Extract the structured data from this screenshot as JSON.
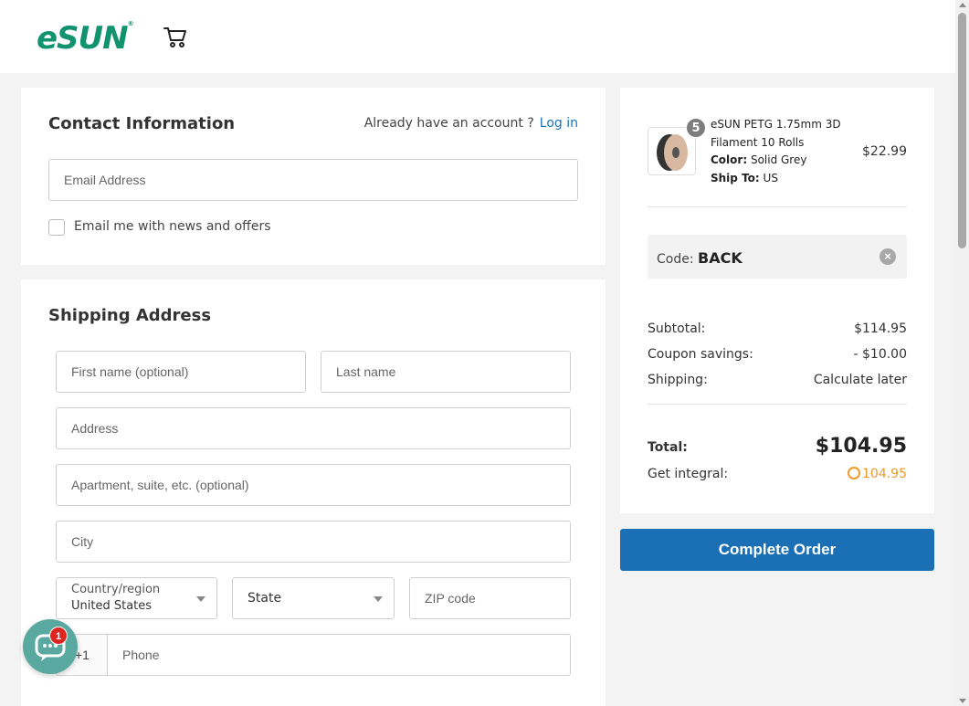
{
  "header": {
    "logo_text": "eSUN",
    "logo_mark": "®",
    "cart_icon": "cart-icon"
  },
  "contact": {
    "title": "Contact Information",
    "account_prompt": "Already have an account ?",
    "login_label": "Log in",
    "email_placeholder": "Email Address",
    "email_value": "",
    "newsletter_label": "Email me with news and offers",
    "newsletter_checked": false
  },
  "shipping": {
    "title": "Shipping Address",
    "first_name_placeholder": "First name (optional)",
    "last_name_placeholder": "Last name",
    "address_placeholder": "Address",
    "apartment_placeholder": "Apartment, suite, etc. (optional)",
    "city_placeholder": "City",
    "country_label": "Country/region",
    "country_value": "United States",
    "state_value": "State",
    "zip_placeholder": "ZIP code",
    "phone_prefix": "+1",
    "phone_placeholder": "Phone"
  },
  "summary": {
    "item": {
      "quantity": "5",
      "name": "eSUN PETG 1.75mm 3D Filament 10 Rolls",
      "color_label": "Color:",
      "color_value": "Solid Grey",
      "ship_label": "Ship To:",
      "ship_value": "US",
      "price": "$22.99"
    },
    "code_label": "Code:",
    "code_value": "BACK",
    "subtotal_label": "Subtotal:",
    "subtotal_value": "$114.95",
    "coupon_label": "Coupon savings:",
    "coupon_value": "- $10.00",
    "shipping_label": "Shipping:",
    "shipping_value": "Calculate later",
    "total_label": "Total:",
    "total_value": "$104.95",
    "integral_label": "Get integral:",
    "integral_value": "104.95"
  },
  "complete_button": "Complete Order",
  "chat": {
    "badge_count": "1"
  },
  "colors": {
    "brand_green": "#12936f",
    "link_blue": "#1a73b9",
    "button_blue": "#1a6fb5",
    "integral_orange": "#f09a2b",
    "chat_teal": "#5aa9a0",
    "badge_red": "#e0241f"
  }
}
